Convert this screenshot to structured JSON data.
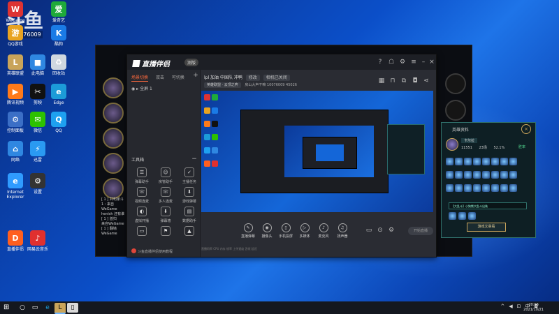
{
  "desktop": {
    "watermark_big": "斗鱼",
    "watermark_id": "10076009",
    "icons": [
      {
        "label": "WeGame",
        "glyph": "W",
        "color": "#d33"
      },
      {
        "label": "爱奇艺",
        "glyph": "爱",
        "color": "#1faa3a"
      },
      {
        "label": "QQ游戏",
        "glyph": "游",
        "color": "#e8a321"
      },
      {
        "label": "酷狗",
        "glyph": "K",
        "color": "#1a7be6"
      },
      {
        "label": "英雄联盟",
        "glyph": "L",
        "color": "#c9a45a"
      },
      {
        "label": "此电脑",
        "glyph": "■",
        "color": "#2f87e1"
      },
      {
        "label": "回收站",
        "glyph": "♻",
        "color": "#cfd8e0"
      },
      {
        "label": "腾讯视频",
        "glyph": "▶",
        "color": "#ff7a1a"
      },
      {
        "label": "剪映",
        "glyph": "✂",
        "color": "#111"
      },
      {
        "label": "Edge",
        "glyph": "e",
        "color": "#1c9bd8"
      },
      {
        "label": "控制面板",
        "glyph": "⚙",
        "color": "#3b6fc6"
      },
      {
        "label": "微信",
        "glyph": "✉",
        "color": "#2dc100"
      },
      {
        "label": "QQ",
        "glyph": "Q",
        "color": "#1ea0f0"
      },
      {
        "label": "网络",
        "glyph": "⌂",
        "color": "#2f87e1"
      },
      {
        "label": "迅雷",
        "glyph": "⚡",
        "color": "#2a9af2"
      },
      {
        "label": "Internet Explorer",
        "glyph": "e",
        "color": "#2f9bff"
      },
      {
        "label": "设置",
        "glyph": "⚙",
        "color": "#333"
      },
      {
        "label": "直播伴侣",
        "glyph": "D",
        "color": "#ff5f1f"
      },
      {
        "label": "网易云音乐",
        "glyph": "♪",
        "color": "#e0302f"
      }
    ]
  },
  "game": {
    "chat_lines": [
      "[ 1 ] 共利家斗",
      "1 : 来自WeGame",
      "henish 还有谁",
      "[ 1 ] 首扫",
      "来自WeGame",
      "[ 1 ] 翻墙",
      "WeGame"
    ]
  },
  "app": {
    "logo": "直播伴侣",
    "badge": "测版",
    "tabs": [
      "场景切换",
      "双击",
      "可切换"
    ],
    "scene": "全屏 1",
    "tools_title": "工具箱",
    "tools": [
      {
        "label": "弹幕助手",
        "glyph": "☰"
      },
      {
        "label": "房管助手",
        "glyph": "☺"
      },
      {
        "label": "主播任务",
        "glyph": "✓"
      },
      {
        "label": "视频连麦",
        "glyph": "☏"
      },
      {
        "label": "多人连麦",
        "glyph": "☏"
      },
      {
        "label": "游戏弹幕",
        "glyph": "⬇"
      },
      {
        "label": "虚拟开播",
        "glyph": "◐"
      },
      {
        "label": "弹幕墙",
        "glyph": "⬇"
      },
      {
        "label": "数据助手",
        "glyph": "▤"
      },
      {
        "label": "",
        "glyph": "▭"
      },
      {
        "label": "",
        "glyph": "⚑"
      },
      {
        "label": "",
        "glyph": "▲"
      }
    ],
    "notice": "斗鱼直播伴侣使用教程",
    "room_title": "lpl 加油 中国队 冲鸭",
    "room_pill1": "修改",
    "room_pill2": "相机已关闭",
    "room_cat1": "英雄联盟 · 云顶之弈",
    "room_cat2": "房山大声干嘛",
    "room_id": "10076009",
    "room_fans": "45026",
    "bottom_buttons": [
      {
        "label": "直播弹幕",
        "glyph": "✎"
      },
      {
        "label": "摄像头",
        "glyph": "◉"
      },
      {
        "label": "手机投屏",
        "glyph": "▯"
      },
      {
        "label": "多媒体",
        "glyph": "▷"
      },
      {
        "label": "麦克风",
        "glyph": "♪"
      },
      {
        "label": "扬声器",
        "glyph": "♫"
      }
    ],
    "start_live": "开始直播",
    "status": "直播码率 CPU  内存  帧率 上传速度  丢帧  延迟"
  },
  "hero_panel": {
    "title": "英雄资料",
    "name": "卡尔拉 ",
    "stat1": "11551",
    "stat2": "23场",
    "stat3": "52.1%",
    "tag": "胜率",
    "select": "【大乱斗】小狗熊大乱斗出装",
    "button": "游戏文章看"
  },
  "taskbar": {
    "start": "⊞",
    "time": "20:16",
    "date": "2021/10/21",
    "tray": [
      "^",
      "◀",
      "⊡",
      "中",
      "◘"
    ]
  }
}
